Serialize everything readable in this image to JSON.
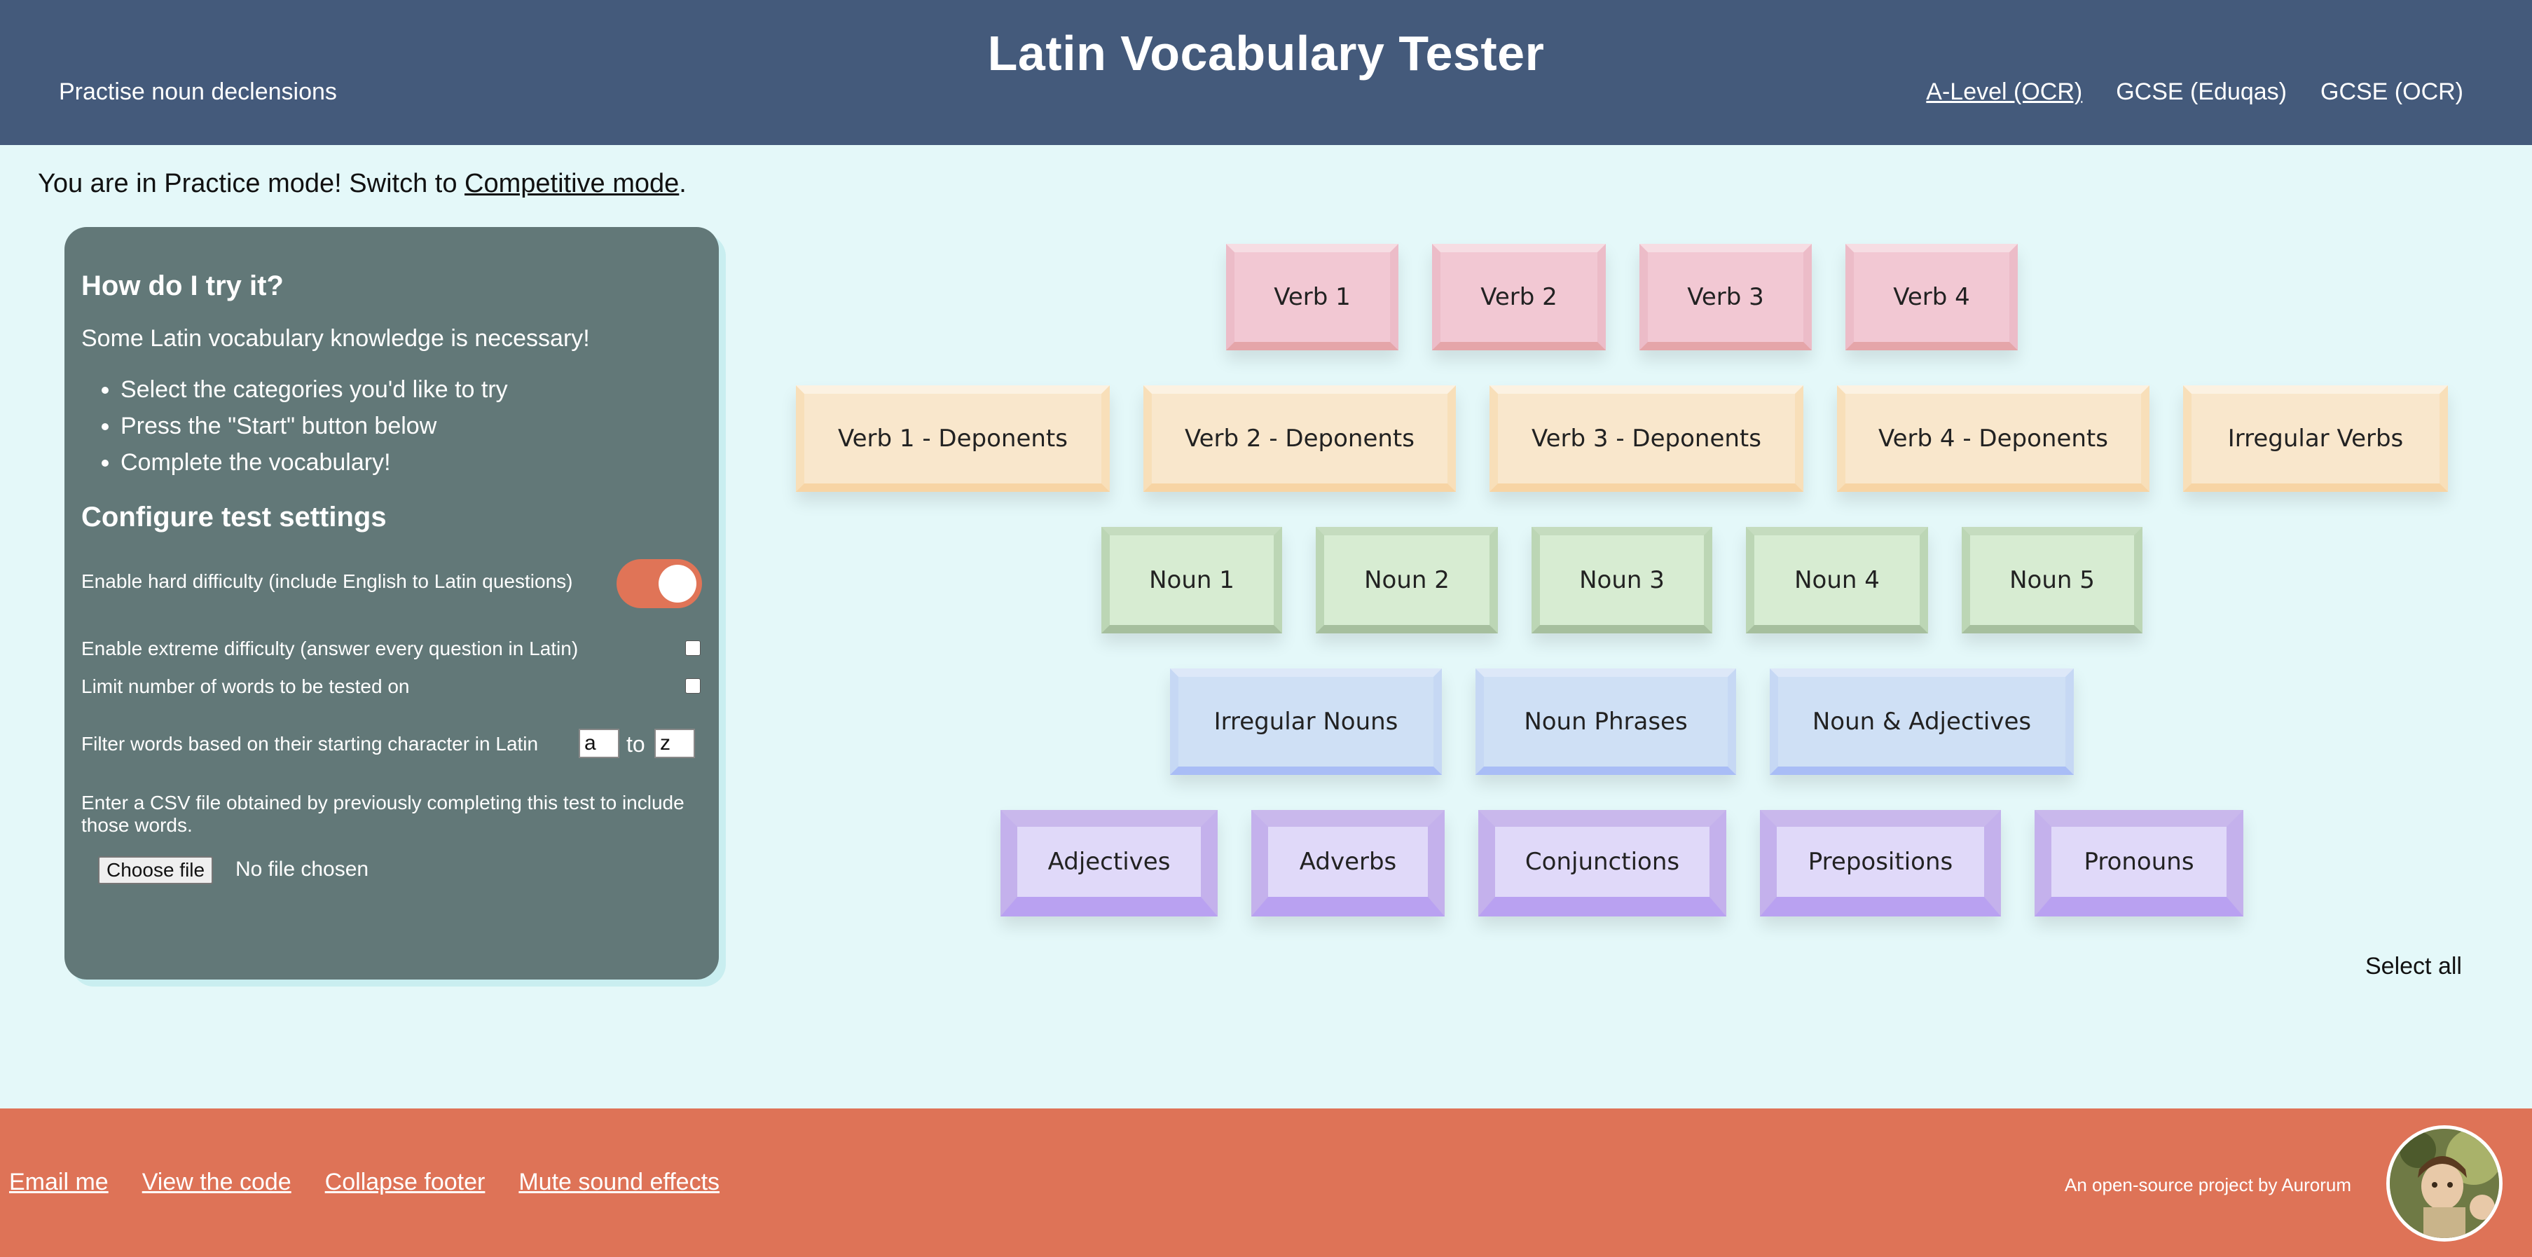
{
  "header": {
    "title": "Latin Vocabulary Tester",
    "subtitle": "Practise noun declensions",
    "nav": [
      "A-Level (OCR)",
      "GCSE (Eduqas)",
      "GCSE (OCR)"
    ]
  },
  "mode": {
    "prefix": "You are in Practice mode! Switch to ",
    "link": "Competitive mode",
    "suffix": "."
  },
  "panel": {
    "how_title": "How do I try it?",
    "intro": "Some Latin vocabulary knowledge is necessary!",
    "steps": [
      "Select the categories you'd like to try",
      "Press the \"Start\" button below",
      "Complete the vocabulary!"
    ],
    "config_title": "Configure test settings",
    "settings": {
      "hard": {
        "label": "Enable hard difficulty (include English to Latin questions)",
        "enabled": true
      },
      "extreme": {
        "label": "Enable extreme difficulty (answer every question in Latin)",
        "checked": false
      },
      "limit": {
        "label": "Limit number of words to be tested on",
        "checked": false
      },
      "filter": {
        "label": "Filter words based on their starting character in Latin",
        "from": "a",
        "to_label": "to",
        "to": "z"
      },
      "csv": {
        "label": "Enter a CSV file obtained by previously completing this test to include those words.",
        "button": "Choose file",
        "status": "No file chosen"
      }
    }
  },
  "categories": {
    "verbs": [
      "Verb 1",
      "Verb 2",
      "Verb 3",
      "Verb 4"
    ],
    "deponents": [
      "Verb 1 - Deponents",
      "Verb 2 - Deponents",
      "Verb 3 - Deponents",
      "Verb 4 - Deponents",
      "Irregular Verbs"
    ],
    "nouns": [
      "Noun 1",
      "Noun 2",
      "Noun 3",
      "Noun 4",
      "Noun 5"
    ],
    "phrases": [
      "Irregular Nouns",
      "Noun Phrases",
      "Noun & Adjectives"
    ],
    "other": [
      "Adjectives",
      "Adverbs",
      "Conjunctions",
      "Prepositions",
      "Pronouns"
    ],
    "select_all": "Select all"
  },
  "footer": {
    "links": [
      "Email me",
      "View the code",
      "Collapse footer",
      "Mute sound effects"
    ],
    "credit": "An open-source project by Aurorum"
  }
}
